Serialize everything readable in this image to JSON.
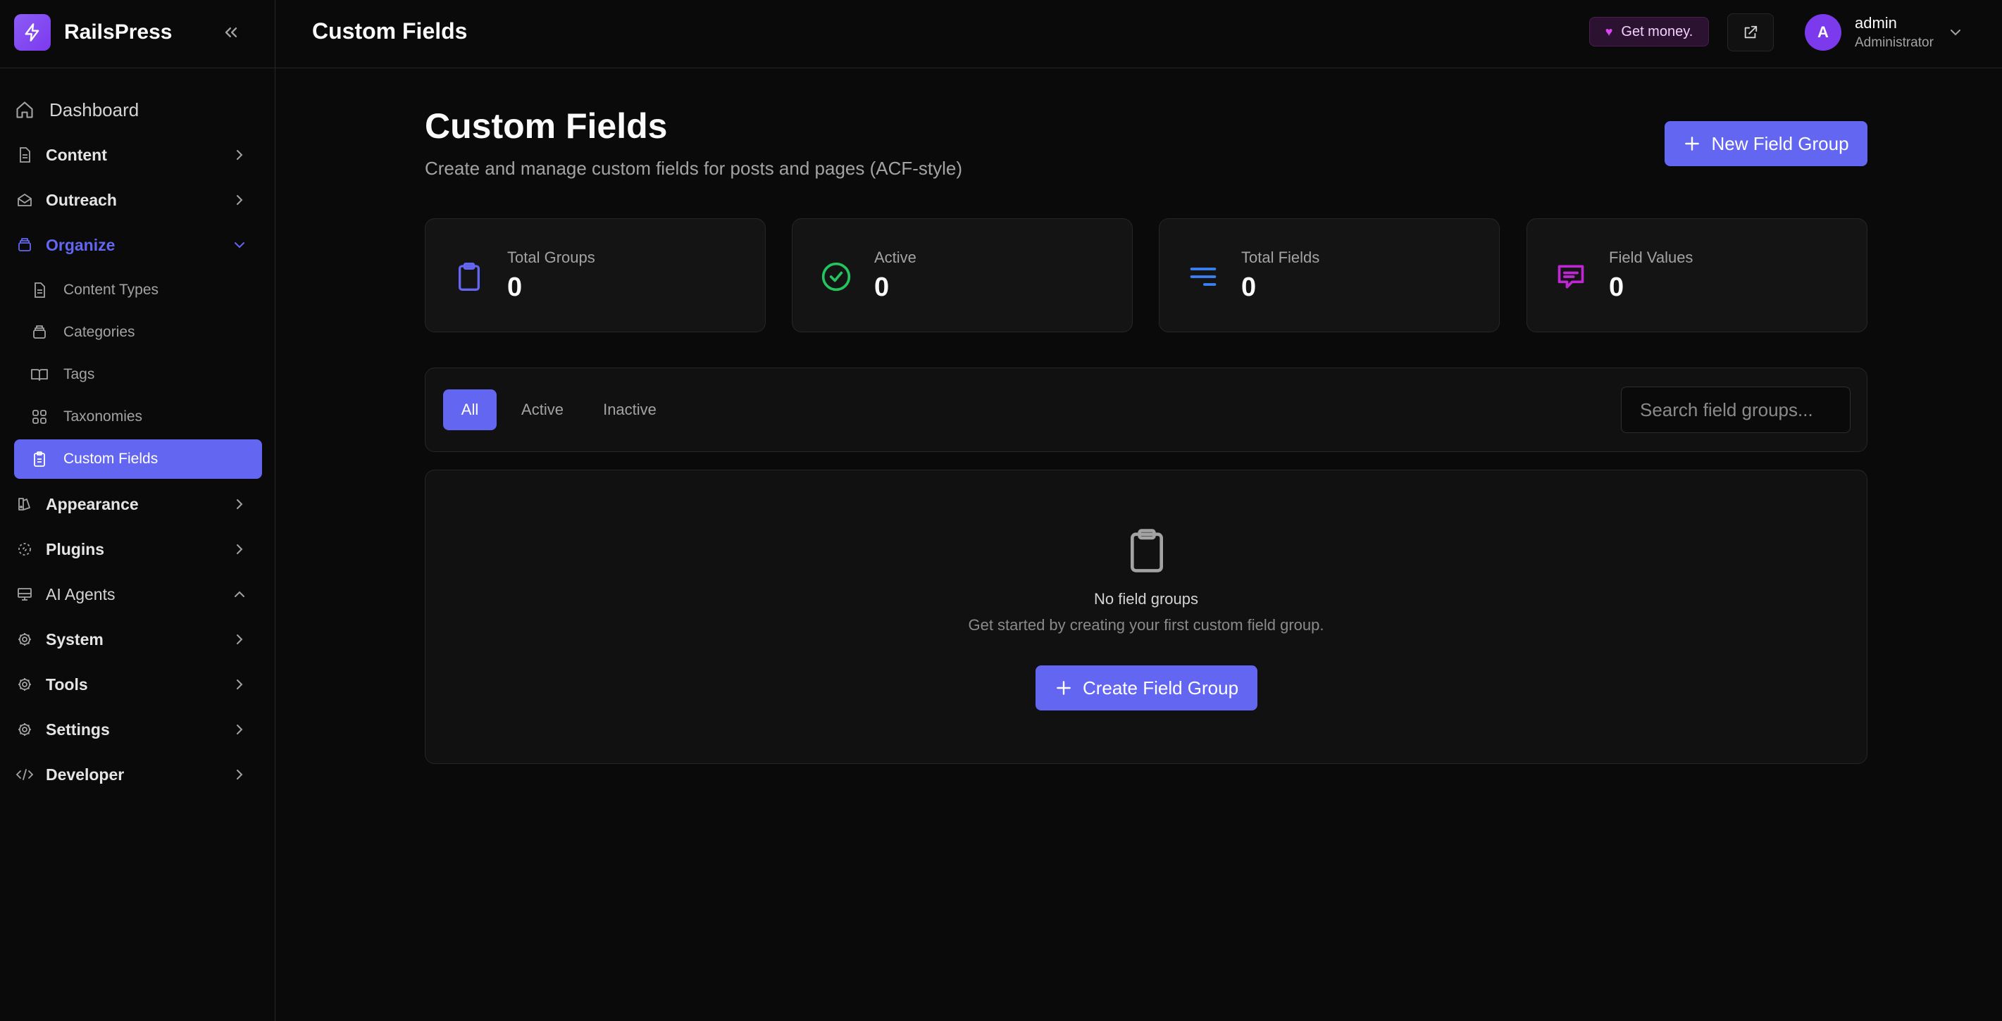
{
  "app": {
    "name": "RailsPress"
  },
  "header": {
    "title": "Custom Fields",
    "badge": "Get money.",
    "user": {
      "initial": "A",
      "name": "admin",
      "role": "Administrator"
    }
  },
  "sidebar": {
    "items": [
      {
        "label": "Dashboard"
      },
      {
        "label": "Content"
      },
      {
        "label": "Outreach"
      },
      {
        "label": "Organize"
      },
      {
        "label": "Appearance"
      },
      {
        "label": "Plugins"
      },
      {
        "label": "AI Agents"
      },
      {
        "label": "System"
      },
      {
        "label": "Tools"
      },
      {
        "label": "Settings"
      },
      {
        "label": "Developer"
      }
    ],
    "organize_children": [
      {
        "label": "Content Types"
      },
      {
        "label": "Categories"
      },
      {
        "label": "Tags"
      },
      {
        "label": "Taxonomies"
      },
      {
        "label": "Custom Fields"
      }
    ],
    "active_item": "Custom Fields"
  },
  "main": {
    "title": "Custom Fields",
    "subtitle": "Create and manage custom fields for posts and pages (ACF-style)",
    "new_button": "New Field Group",
    "stats": [
      {
        "label": "Total Groups",
        "value": "0",
        "icon": "clipboard-icon",
        "color": "#6366f1"
      },
      {
        "label": "Active",
        "value": "0",
        "icon": "check-circle-icon",
        "color": "#22c55e"
      },
      {
        "label": "Total Fields",
        "value": "0",
        "icon": "lines-icon",
        "color": "#3b82f6"
      },
      {
        "label": "Field Values",
        "value": "0",
        "icon": "message-icon",
        "color": "#c026d3"
      }
    ],
    "tabs": [
      "All",
      "Active",
      "Inactive"
    ],
    "active_tab": "All",
    "search": {
      "placeholder": "Search field groups...",
      "value": ""
    },
    "empty": {
      "title": "No field groups",
      "subtitle": "Get started by creating your first custom field group.",
      "button": "Create Field Group"
    }
  }
}
